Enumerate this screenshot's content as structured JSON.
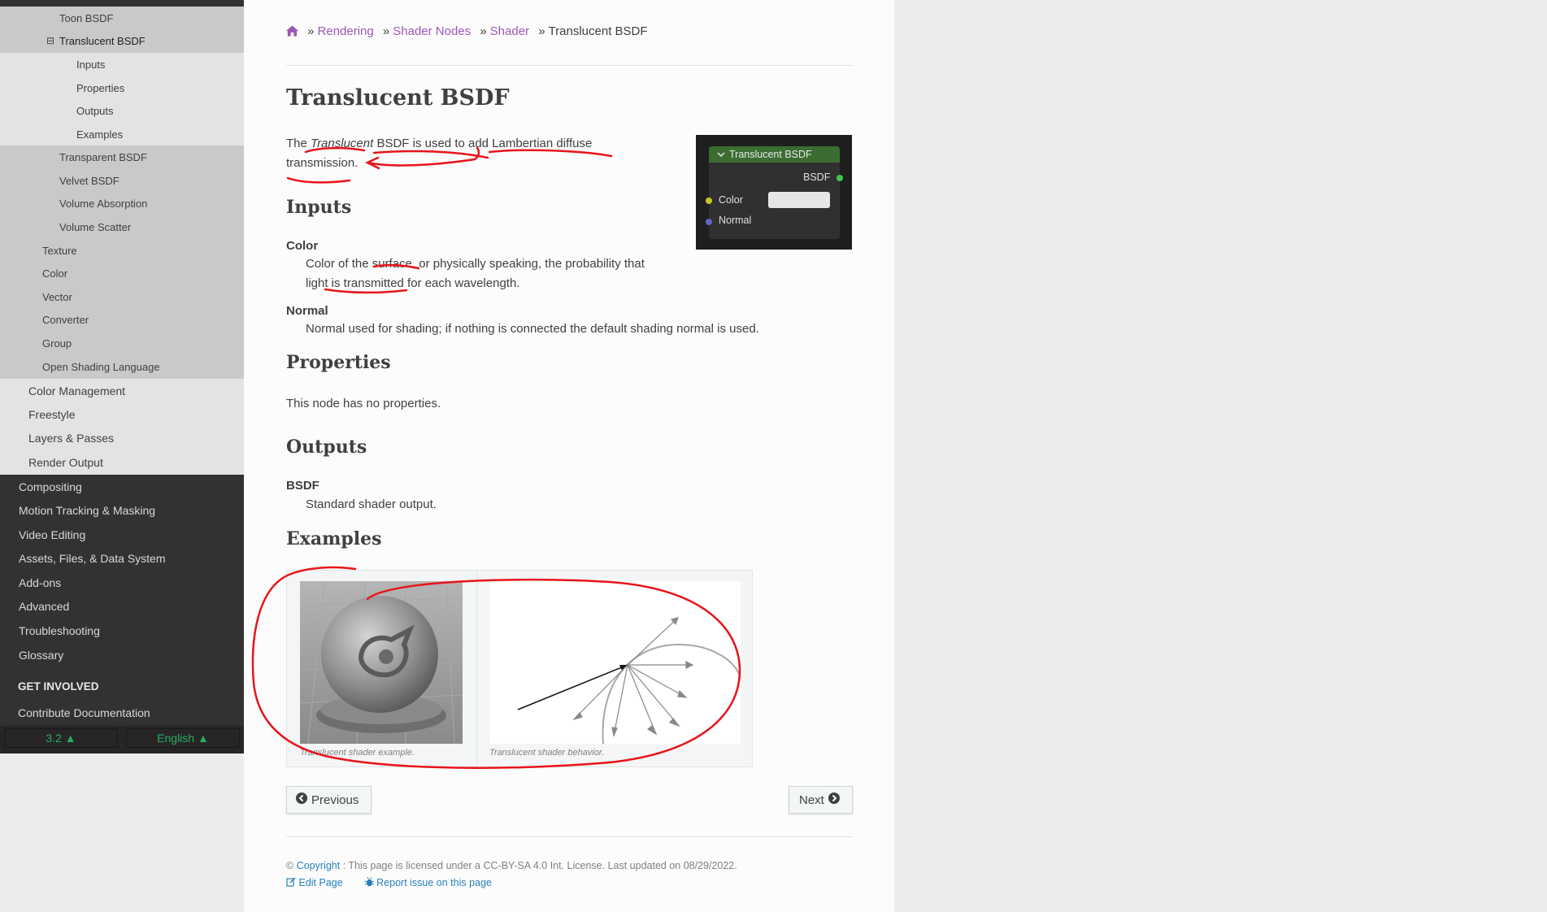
{
  "sidebar": {
    "level3_items": [
      {
        "label": "Toon BSDF"
      },
      {
        "label": "Translucent BSDF",
        "expander": "⊟"
      }
    ],
    "level4_items": [
      {
        "label": "Inputs"
      },
      {
        "label": "Properties"
      },
      {
        "label": "Outputs"
      },
      {
        "label": "Examples"
      }
    ],
    "level3_items_after": [
      {
        "label": "Transparent BSDF"
      },
      {
        "label": "Velvet BSDF"
      },
      {
        "label": "Volume Absorption"
      },
      {
        "label": "Volume Scatter"
      }
    ],
    "level2_groups": [
      {
        "label": "Texture"
      },
      {
        "label": "Color"
      },
      {
        "label": "Vector"
      },
      {
        "label": "Converter"
      },
      {
        "label": "Group"
      },
      {
        "label": "Open Shading Language"
      }
    ],
    "level1_render": [
      {
        "label": "Color Management"
      },
      {
        "label": "Freestyle"
      },
      {
        "label": "Layers & Passes"
      },
      {
        "label": "Render Output"
      }
    ],
    "top_items": [
      {
        "label": "Compositing"
      },
      {
        "label": "Motion Tracking & Masking"
      },
      {
        "label": "Video Editing"
      },
      {
        "label": "Assets, Files, & Data System"
      },
      {
        "label": "Add-ons"
      },
      {
        "label": "Advanced"
      },
      {
        "label": "Troubleshooting"
      },
      {
        "label": "Glossary"
      }
    ],
    "get_involved": "GET INVOLVED",
    "contribute": "Contribute Documentation",
    "version": "3.2 ▲",
    "language": "English ▲"
  },
  "breadcrumb": {
    "separator": "»",
    "items": [
      "Rendering",
      "Shader Nodes",
      "Shader"
    ],
    "current": "Translucent BSDF"
  },
  "page": {
    "title": "Translucent BSDF",
    "intro_pre": "The ",
    "intro_em": "Translucent",
    "intro_post": " BSDF is used to add Lambertian diffuse",
    "intro_line2": "transmission.",
    "inputs_heading": "Inputs",
    "color_term": "Color",
    "color_desc_1": "Color of the surface, or physically speaking, the probability that",
    "color_desc_2": "light is transmitted for each wavelength.",
    "normal_term": "Normal",
    "normal_desc": "Normal used for shading; if nothing is connected the default shading normal is used.",
    "properties_heading": "Properties",
    "properties_text": "This node has no properties.",
    "outputs_heading": "Outputs",
    "bsdf_term": "BSDF",
    "bsdf_desc": "Standard shader output.",
    "examples_heading": "Examples",
    "caption_1": "Translucent shader example.",
    "caption_2": "Translucent shader behavior."
  },
  "node": {
    "title": "Translucent BSDF",
    "output": "BSDF",
    "input_color": "Color",
    "input_normal": "Normal",
    "header_color": "#3b6d32",
    "color_socket": "#c7c729",
    "normal_socket": "#6363c7",
    "output_socket": "#39c751"
  },
  "nav": {
    "previous": "Previous",
    "next": "Next"
  },
  "footer": {
    "copyright_symbol": "©",
    "copyright_link": "Copyright",
    "license_text": ": This page is licensed under a CC-BY-SA 4.0 Int. License. Last updated on 08/29/2022.",
    "edit_page": "Edit Page",
    "report_issue": "Report issue on this page"
  },
  "colors": {
    "link_purple": "#9b59b6",
    "link_blue": "#2980b9",
    "sidebar_dark": "#343131",
    "accent_green": "#27ae60",
    "annotation_red": "#e8141a"
  }
}
